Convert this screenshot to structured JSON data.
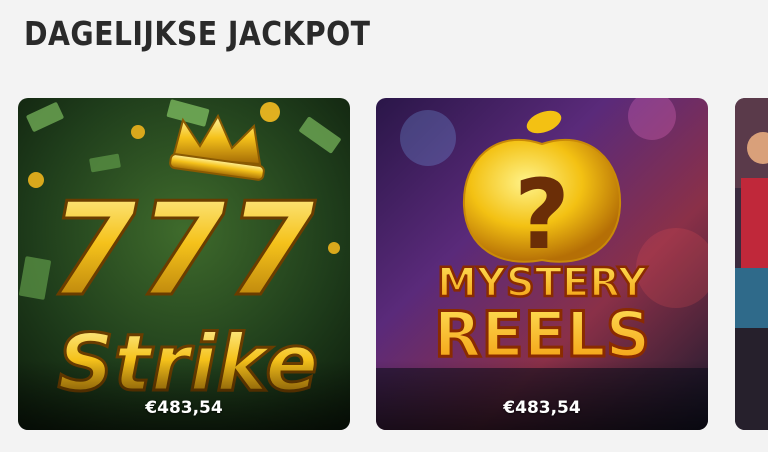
{
  "section": {
    "title": "DAGELIJKSE JACKPOT"
  },
  "games": [
    {
      "title_line1": "777",
      "title_line2": "Strike",
      "jackpot": "€483,54"
    },
    {
      "title_line1": "MYSTERY",
      "title_line2": "REELS",
      "jackpot": "€483,54"
    },
    {
      "jackpot": ""
    }
  ],
  "colors": {
    "page_bg": "#f3f3f3",
    "title_text": "#2a2a2a",
    "gold": "#f5c21b",
    "card1_bg": "#1d3b1a",
    "card2_bg": "#3a1a5a"
  }
}
